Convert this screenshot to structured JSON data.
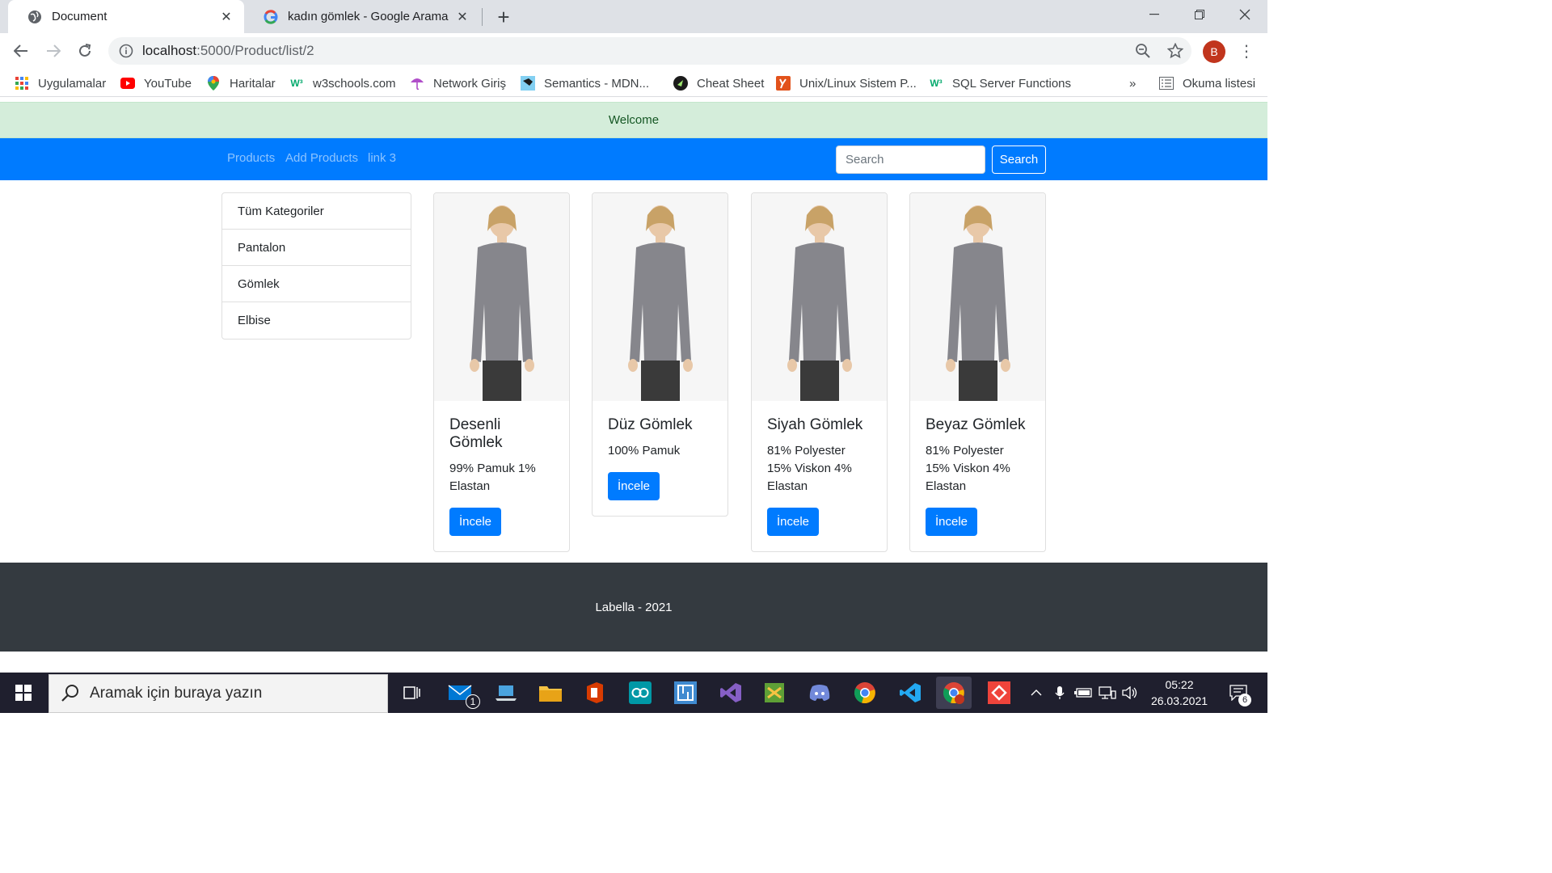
{
  "browser": {
    "tabs": [
      {
        "title": "Document",
        "icon": "globe-icon",
        "active": true
      },
      {
        "title": "kadın gömlek - Google Arama",
        "icon": "google-icon",
        "active": false
      }
    ],
    "url_host": "localhost",
    "url_path": ":5000/Product/list/2",
    "profile_initial": "B",
    "bookmarks": [
      {
        "label": "Uygulamalar",
        "icon": "apps-grid-icon"
      },
      {
        "label": "YouTube",
        "icon": "youtube-icon"
      },
      {
        "label": "Haritalar",
        "icon": "maps-pin-icon"
      },
      {
        "label": "w3schools.com",
        "icon": "w3schools-icon"
      },
      {
        "label": "Network Giriş",
        "icon": "network-icon"
      },
      {
        "label": "Semantics - MDN...",
        "icon": "mdn-icon"
      },
      {
        "label": "Cheat Sheet",
        "icon": "cheatsheet-icon"
      },
      {
        "label": "Unix/Linux Sistem P...",
        "icon": "unix-icon"
      },
      {
        "label": "SQL Server Functions",
        "icon": "w3schools-icon"
      }
    ],
    "bookmarks_overflow": "»",
    "reading_list": "Okuma listesi"
  },
  "page": {
    "alert": "Welcome",
    "nav": {
      "links": [
        "Products",
        "Add Products",
        "link 3"
      ],
      "search_placeholder": "Search",
      "search_button": "Search"
    },
    "categories": [
      "Tüm Kategoriler",
      "Pantalon",
      "Gömlek",
      "Elbise"
    ],
    "products": [
      {
        "title": "Desenli Gömlek",
        "description": "99% Pamuk 1% Elastan",
        "button": "İncele"
      },
      {
        "title": "Düz Gömlek",
        "description": "100% Pamuk",
        "button": "İncele"
      },
      {
        "title": "Siyah Gömlek",
        "description": "81% Polyester 15% Viskon 4% Elastan",
        "button": "İncele"
      },
      {
        "title": "Beyaz Gömlek",
        "description": "81% Polyester 15% Viskon 4% Elastan",
        "button": "İncele"
      }
    ],
    "footer": "Labella - 2021"
  },
  "taskbar": {
    "search_placeholder": "Aramak için buraya yazın",
    "time": "05:22",
    "date": "26.03.2021",
    "mail_badge": "1",
    "notification_badge": "6"
  },
  "colors": {
    "primary": "#007bff",
    "alert_bg": "#d4edda",
    "alert_text": "#155724",
    "footer_bg": "#343a40"
  }
}
